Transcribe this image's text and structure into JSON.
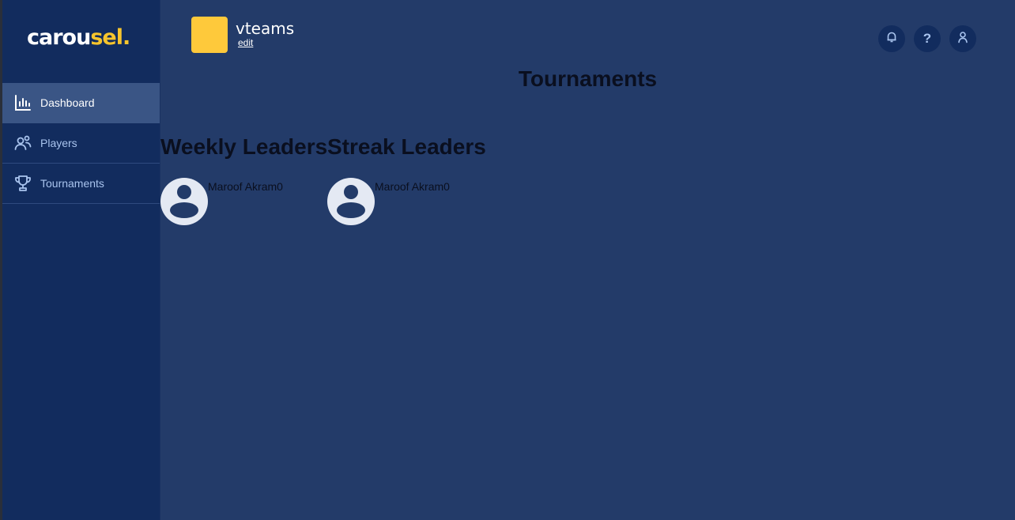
{
  "brand": {
    "part1": "carou",
    "part2": "sel."
  },
  "sidebar": {
    "items": [
      {
        "label": "Dashboard",
        "icon": "bar-chart-icon"
      },
      {
        "label": "Players",
        "icon": "users-icon"
      },
      {
        "label": "Tournaments",
        "icon": "trophy-icon"
      }
    ]
  },
  "team": {
    "name": "vteams",
    "edit_label": "edit"
  },
  "header": {
    "icons": [
      "bell-icon",
      "help-icon",
      "user-icon"
    ]
  },
  "page": {
    "title": "Tournaments"
  },
  "weekly": {
    "title": "Weekly Leaders",
    "leaders": [
      {
        "name": "Maroof Akram",
        "score": "0"
      }
    ]
  },
  "streak": {
    "title": "Streak Leaders",
    "leaders": [
      {
        "name": "Maroof Akram",
        "score": "0"
      }
    ]
  },
  "colors": {
    "background": "#233b69",
    "sidebar": "#122c5e",
    "active": "#3a5585",
    "accent": "#f7c52d",
    "badge": "#fec93b"
  }
}
